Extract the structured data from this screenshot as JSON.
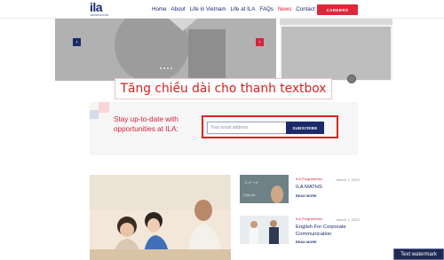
{
  "header": {
    "logo_text": "ila",
    "logo_sub": "INNOVATION",
    "nav": [
      "Home",
      "About",
      "Life in Vietnam",
      "Life at ILA",
      "FAQs",
      "News",
      "Contact"
    ],
    "active_nav": "News",
    "careers_label": "CAREERS"
  },
  "hero": {
    "prev_icon": "chevron-left-icon",
    "next_icon": "chevron-right-icon"
  },
  "annotation": {
    "text": "Tăng chiều dài cho thanh textbox",
    "color": "#d81f1f"
  },
  "subscribe": {
    "heading": "Stay up-to-date with opportunities at ILA:",
    "email_placeholder": "Your email address",
    "button_label": "SUBSCRIBE"
  },
  "articles": [
    {
      "category": "ILA Programmes",
      "date": "March 1, 2023",
      "title": "ILA MATHS",
      "more": "READ MORE"
    },
    {
      "category": "ILA Programmes",
      "date": "March 1, 2023",
      "title": "English For Corporate Communication",
      "more": "READ MORE"
    }
  ],
  "watermark": {
    "label": "Text watermark"
  },
  "colors": {
    "brand_navy": "#1b2a6b",
    "brand_red": "#d6233a"
  }
}
